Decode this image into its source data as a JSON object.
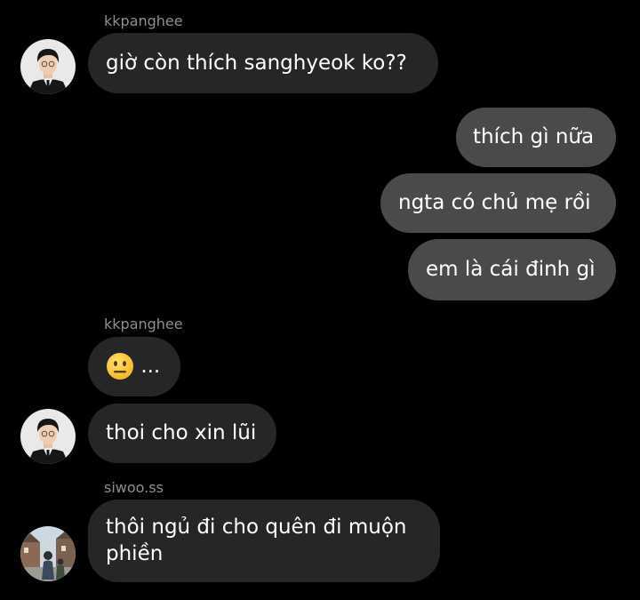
{
  "messages": [
    {
      "sender": "kkpanghee",
      "text": "giờ còn thích sanghyeok ko??"
    },
    {
      "text": "thích gì nữa"
    },
    {
      "text": "ngta có chủ mẹ rồi"
    },
    {
      "text": "em là cái đinh gì"
    },
    {
      "sender": "kkpanghee",
      "emoji": "neutral-face-emoji",
      "text": "..."
    },
    {
      "text": "thoi cho xin lũi"
    },
    {
      "sender": "siwoo.ss",
      "line1": "thôi ngủ đi cho quên đi muộn",
      "line2": "phiền"
    }
  ],
  "colors": {
    "background": "#000000",
    "incoming_bubble": "#262628",
    "outgoing_bubble": "#4a4a4c",
    "sender_label": "#8e8e93",
    "text": "#ffffff"
  }
}
